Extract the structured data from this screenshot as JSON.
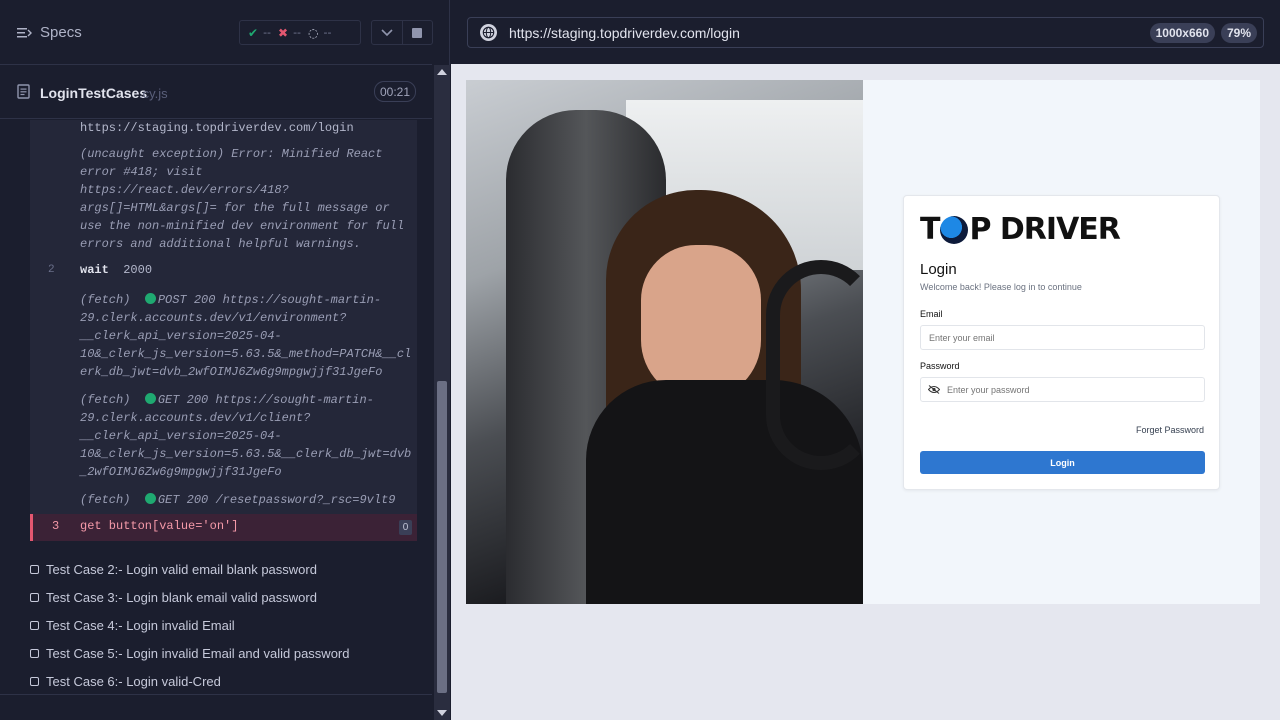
{
  "reporter": {
    "specs_label": "Specs",
    "stats": {
      "passed": "--",
      "failed": "--",
      "pending": "--"
    },
    "file": {
      "name": "LoginTestCases",
      "ext": ".cy.js",
      "duration": "00:21"
    },
    "log": {
      "visit_url": "https://staging.topdriverdev.com/login",
      "exception_lines": [
        "(uncaught exception)  Error: Minified React",
        "error #418; visit",
        "https://react.dev/errors/418?",
        "args[]=HTML&args[]= for the full message or",
        "use the non-minified dev environment for full",
        "errors and additional helpful warnings."
      ],
      "wait": {
        "num": "2",
        "cmd": "wait",
        "arg": "2000"
      },
      "fetch1_lines": [
        "POST 200 https://sought-martin-",
        "29.clerk.accounts.dev/v1/environment?",
        "__clerk_api_version=2025-04-",
        "10&_clerk_js_version=5.63.5&_method=PATCH&__cl",
        "erk_db_jwt=dvb_2wfOIMJ6Zw6g9mpgwjjf31JgeFo"
      ],
      "fetch2_lines": [
        "GET 200 https://sought-martin-",
        "29.clerk.accounts.dev/v1/client?",
        "__clerk_api_version=2025-04-",
        "10&_clerk_js_version=5.63.5&__clerk_db_jwt=dvb",
        "_2wfOIMJ6Zw6g9mpgwjjf31JgeFo"
      ],
      "fetch3": "GET 200 /resetpassword?_rsc=9vlt9",
      "fetch_label": "(fetch)",
      "failed": {
        "num": "3",
        "cmd": "get  button[value='on']",
        "count": "0"
      }
    },
    "tests": [
      "Test Case 2:- Login valid email blank password",
      "Test Case 3:- Login blank email valid password",
      "Test Case 4:- Login invalid Email",
      "Test Case 5:- Login invalid Email and valid password",
      "Test Case 6:- Login valid-Cred"
    ]
  },
  "aut": {
    "url": "https://staging.topdriverdev.com/login",
    "viewport": "1000x660",
    "zoom": "79%",
    "login": {
      "logo_t": "T",
      "logo_rest": "P DRIVER",
      "title": "Login",
      "subtitle": "Welcome back! Please log in to continue",
      "email_label": "Email",
      "email_placeholder": "Enter your email",
      "password_label": "Password",
      "password_placeholder": "Enter your password",
      "forget": "Forget Password",
      "button": "Login"
    }
  },
  "colors": {
    "pass": "#1fa971",
    "fail": "#e45770",
    "accent": "#2e77d0"
  }
}
